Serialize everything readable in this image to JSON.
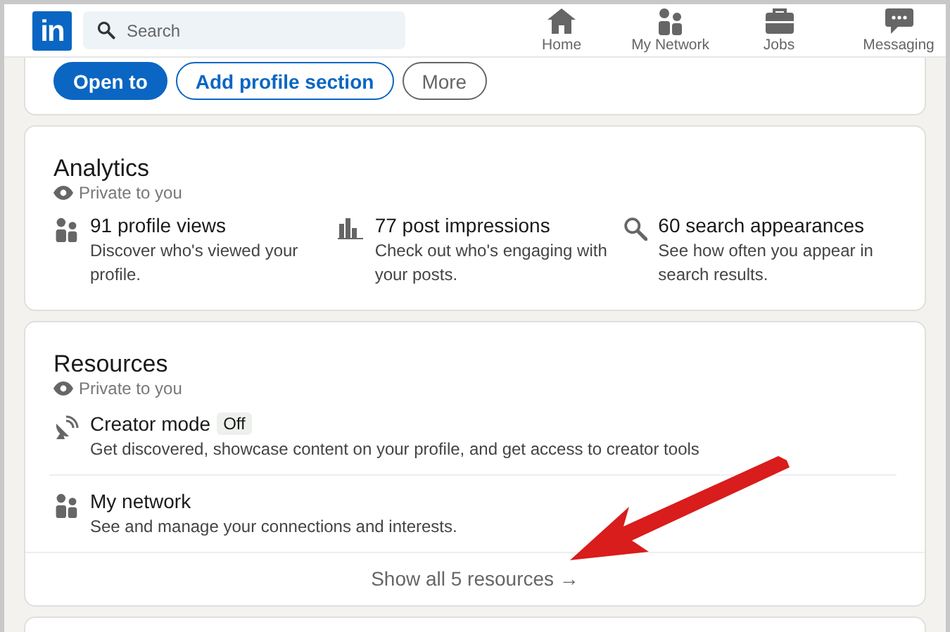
{
  "header": {
    "logo": "in",
    "search": {
      "placeholder": "Search"
    },
    "nav": [
      {
        "kind": "home",
        "label": "Home"
      },
      {
        "kind": "network",
        "label": "My Network"
      },
      {
        "kind": "jobs",
        "label": "Jobs"
      },
      {
        "kind": "messaging",
        "label": "Messaging"
      }
    ]
  },
  "profile_actions": [
    {
      "kind": "primary",
      "label": "Open to"
    },
    {
      "kind": "outline",
      "label": "Add profile section"
    },
    {
      "kind": "secondary",
      "label": "More"
    }
  ],
  "analytics": {
    "title": "Analytics",
    "privacy": "Private to you",
    "items": [
      {
        "kind": "people",
        "title": "91 profile views",
        "description": "Discover who's viewed your profile."
      },
      {
        "kind": "chart",
        "title": "77 post impressions",
        "description": "Check out who's engaging with your posts."
      },
      {
        "kind": "search",
        "title": "60 search appearances",
        "description": "See how often you appear in search results."
      }
    ]
  },
  "resources": {
    "title": "Resources",
    "privacy": "Private to you",
    "items": [
      {
        "kind": "creator",
        "title": "Creator mode",
        "badge": "Off",
        "description": "Get discovered, showcase content on your profile, and get access to creator tools"
      },
      {
        "kind": "people",
        "title": "My network",
        "description": "See and manage your connections and interests."
      }
    ],
    "footer_link": "Show all 5 resources",
    "footer_arrow": "→"
  }
}
